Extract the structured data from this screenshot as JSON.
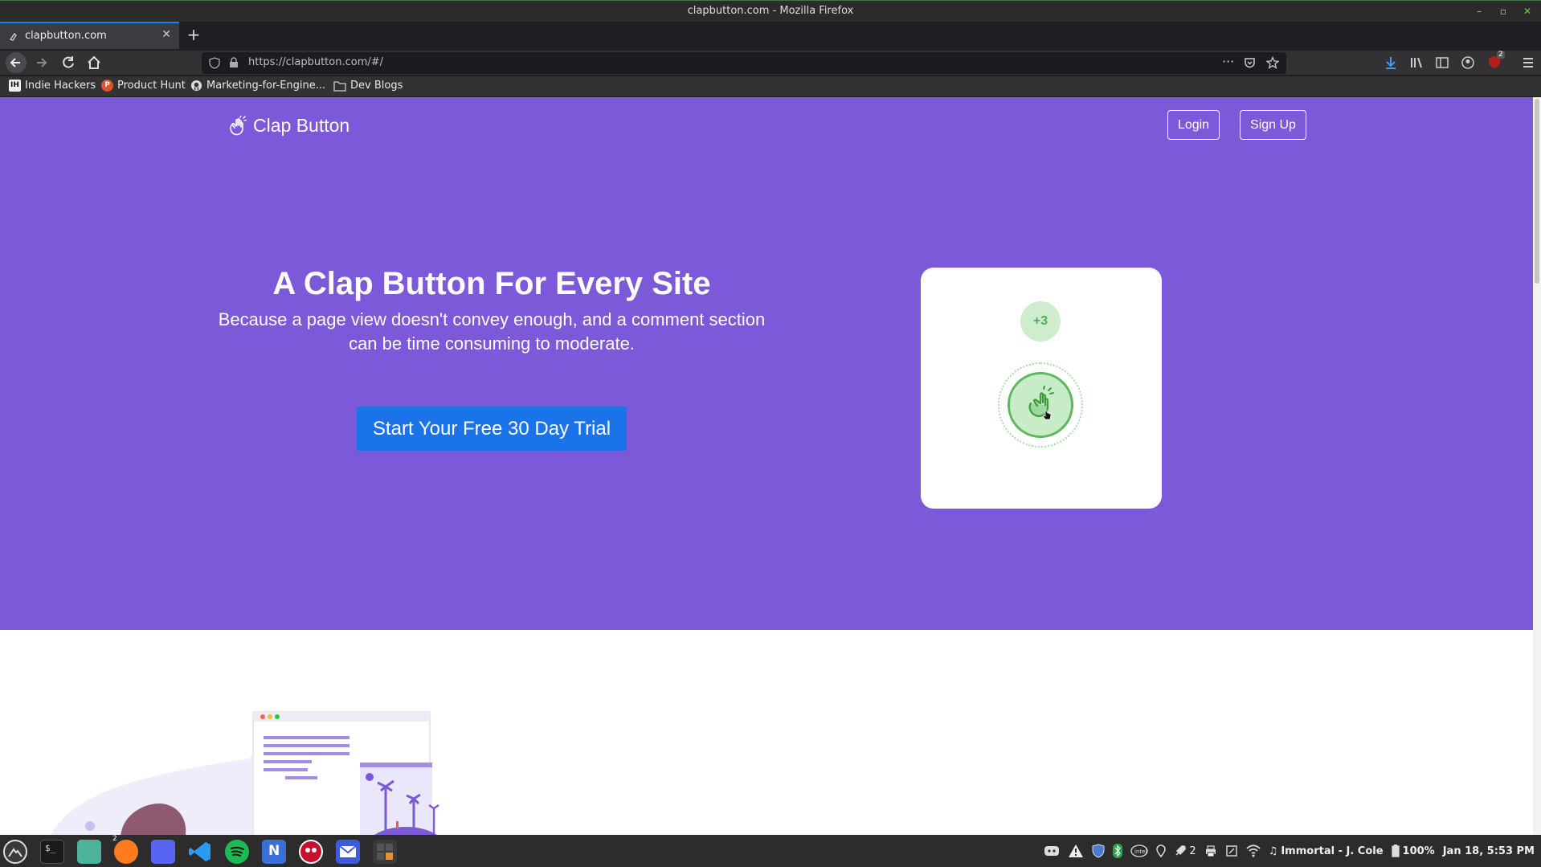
{
  "window": {
    "title": "clapbutton.com - Mozilla Firefox"
  },
  "tab": {
    "label": "clapbutton.com"
  },
  "urlbar": {
    "url": "https://clapbutton.com/#/"
  },
  "bookmarks": [
    {
      "label": "Indie Hackers",
      "icon": "IH"
    },
    {
      "label": "Product Hunt",
      "icon": "P"
    },
    {
      "label": "Marketing-for-Engine...",
      "icon": "github"
    },
    {
      "label": "Dev Blogs",
      "icon": "folder"
    }
  ],
  "site": {
    "brand": "Clap Button",
    "login_label": "Login",
    "signup_label": "Sign Up",
    "headline": "A Clap Button For Every Site",
    "subhead": "Because a page view doesn't convey enough, and a comment section can be time consuming to moderate.",
    "cta_label": "Start Your Free 30 Day Trial",
    "clap_count": "+3"
  },
  "colors": {
    "hero_bg": "#7b59d8",
    "cta_bg": "#1a73e8",
    "clap_green": "#5cb85c"
  },
  "taskbar": {
    "apps": [
      "menu-icon",
      "terminal-icon",
      "files-icon",
      "firefox-icon",
      "discord-icon",
      "vscode-icon",
      "spotify-icon",
      "notion-icon",
      "ghost-icon",
      "mail-icon",
      "calculator-icon"
    ],
    "firefox_badge": "2",
    "tray_badge_count": "2",
    "now_playing": "Immortal - J. Cole",
    "battery": "100%",
    "datetime": "Jan 18, 5:53 PM"
  },
  "extension_badge": "2"
}
